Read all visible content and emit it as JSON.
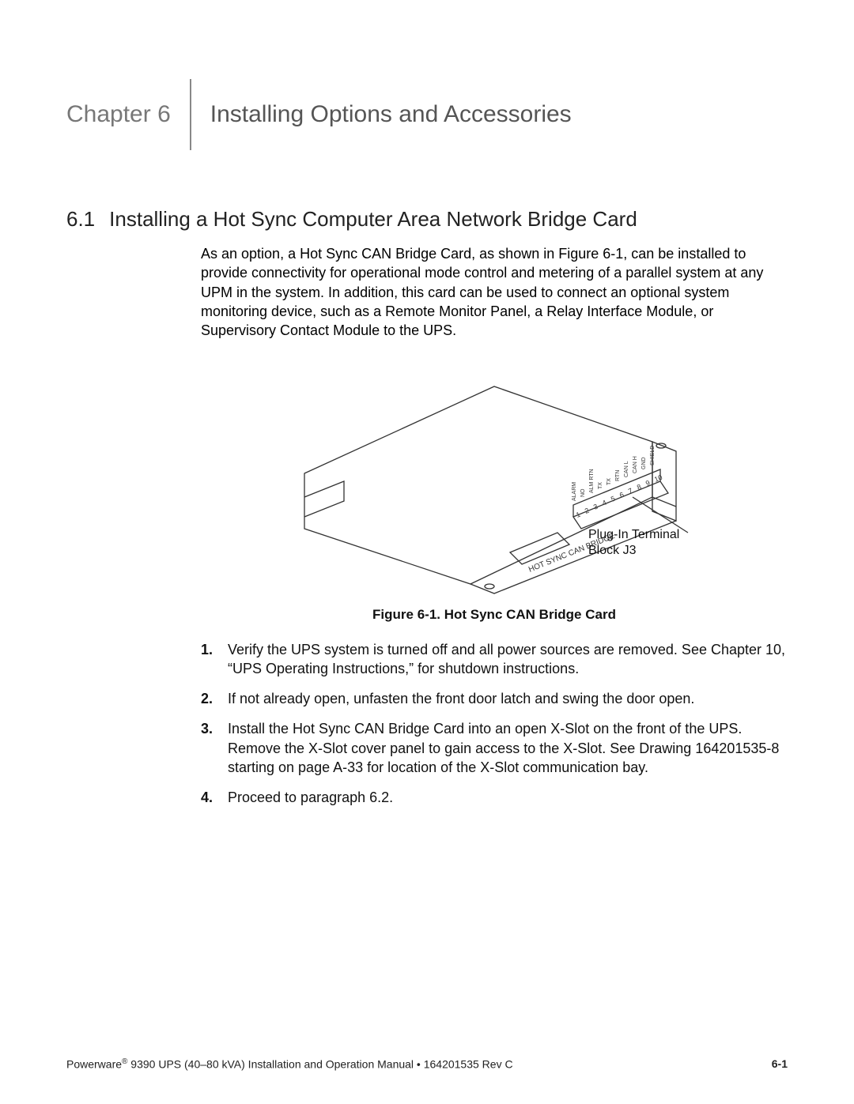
{
  "chapter": {
    "label": "Chapter 6",
    "title": "Installing Options and Accessories"
  },
  "section": {
    "num": "6.1",
    "title": "Installing a Hot Sync Computer Area Network Bridge Card",
    "intro": "As an option, a Hot Sync CAN Bridge Card, as shown in Figure 6-1, can be installed to provide connectivity for operational mode control and metering of a parallel system at any UPM in the system. In addition, this card can be used to connect an optional system monitoring device, such as a Remote Monitor Panel, a Relay Interface Module, or Supervisory Contact Module to the UPS."
  },
  "figure": {
    "caption": "Figure 6-1. Hot Sync CAN Bridge Card",
    "callout1_line1": "Plug-In Terminal",
    "callout1_line2": "Block J3",
    "pcb_label": "HOT SYNC CAN BRIDGE",
    "pin_numbers": [
      "1",
      "2",
      "3",
      "4",
      "5",
      "6",
      "7",
      "8",
      "9",
      "10"
    ],
    "signal_labels": [
      "ALARM",
      "NO",
      "ALM RTN",
      "TX",
      "TX",
      "RTN",
      "CAN L",
      "CAN H",
      "GND",
      "SHIELD"
    ]
  },
  "steps": [
    {
      "num": "1.",
      "text": "Verify the UPS system is turned off and all power sources are removed. See Chapter 10, “UPS Operating Instructions,” for shutdown instructions."
    },
    {
      "num": "2.",
      "text": "If not already open, unfasten the front door latch and swing the door open."
    },
    {
      "num": "3.",
      "text": "Install the Hot Sync CAN Bridge Card into an open X-Slot on the front of the UPS. Remove the X-Slot cover panel to gain access to the X-Slot. See Drawing 164201535-8 starting on page A-33 for location of the X-Slot communication bay."
    },
    {
      "num": "4.",
      "text": "Proceed to paragraph 6.2."
    }
  ],
  "footer": {
    "left_a": "Powerware",
    "left_b": " 9390 UPS (40–80 kVA) Installation and Operation Manual  •  164201535 Rev C",
    "pagenum": "6-1"
  }
}
